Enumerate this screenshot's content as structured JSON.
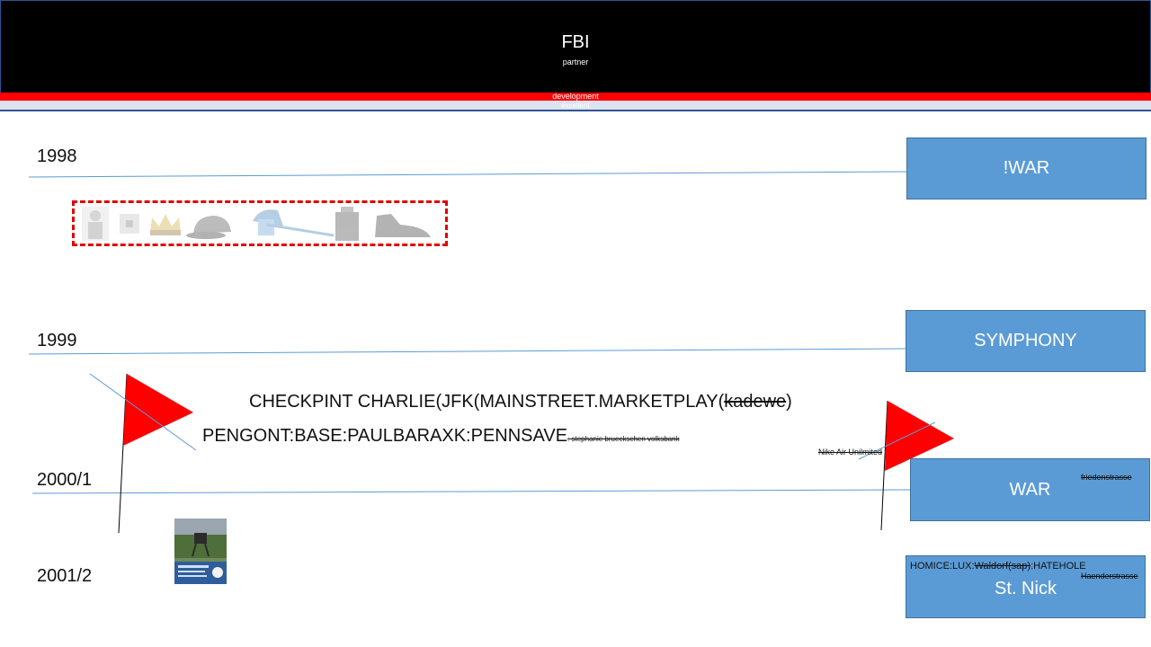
{
  "header": {
    "title": "FBI",
    "subtitle": "partner",
    "bar_label": "development",
    "bar2_label": "excellent"
  },
  "timeline": {
    "years": [
      "1998",
      "1999",
      "2000/1",
      "2001/2"
    ],
    "boxes": [
      "!WAR",
      "SYMPHONY",
      "WAR",
      "St. Nick"
    ]
  },
  "notes": {
    "checkpoint": "CHECKPINT CHARLIE(JFK(MAINSTREET.MARKETPLAY(",
    "checkpoint_struck": "kadewe",
    "checkpoint_close": ")",
    "pengont": "PENGONT:BASE:PAULBARAXK:PENNSAVE",
    "pengont_small": ": stephanie brueckschen volksbank",
    "nike": "Nike Air Unilmited",
    "friedenstrasse": "friedenstrasse",
    "homice_prefix": "HOMICE:LUX:",
    "homice_struck": "Waldorf(sap)",
    "homice_suffix": ":HATEHOLE",
    "haenderstrasse": "Haenderstrasse"
  },
  "colors": {
    "box_fill": "#5b9bd5",
    "flag": "#ff0000",
    "header_bg": "#000000",
    "accent_red": "#ff0000",
    "line_blue": "#5b9bd5"
  },
  "icons": [
    "person-thumbnail",
    "small-item-thumbnail",
    "crown-thumbnail",
    "cap-thumbnail",
    "blue-cap-thumbnail",
    "bag-thumbnail",
    "shoe-thumbnail",
    "poster-thumbnail"
  ]
}
